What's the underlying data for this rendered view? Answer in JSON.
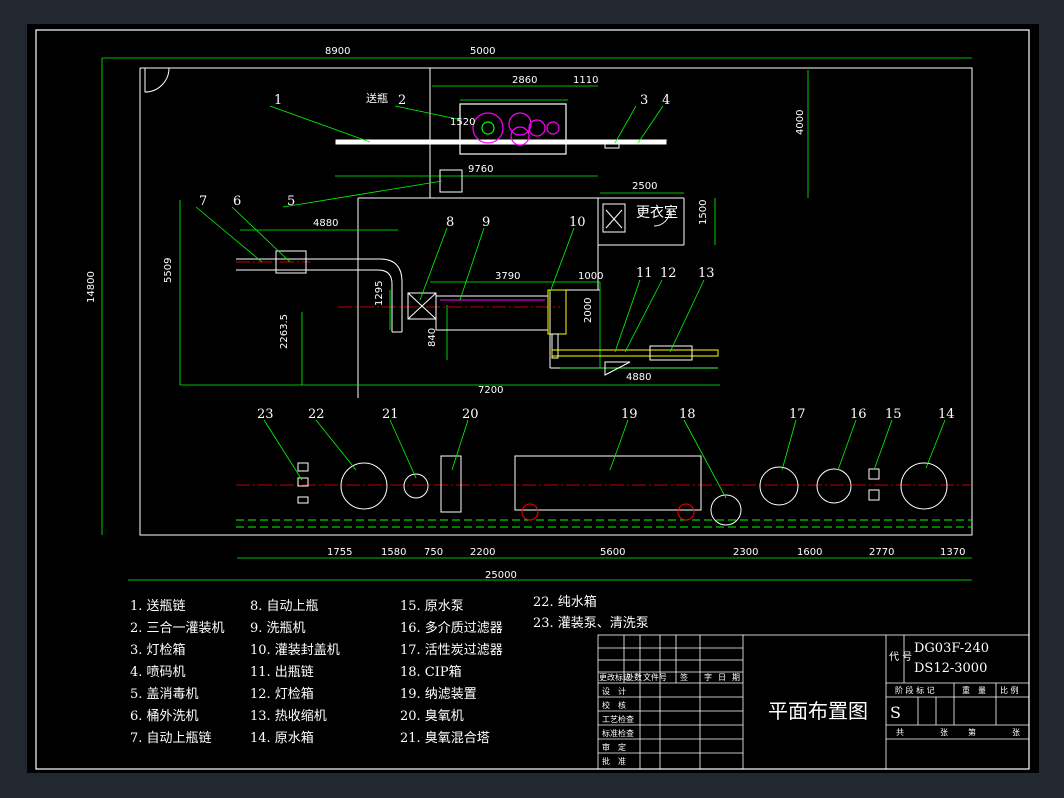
{
  "colors": {
    "background": "#212830",
    "canvas": "#000000",
    "line": "#ffffff",
    "dimension": "#00ff00",
    "leader": "#00ff00",
    "centerline": "#ff0000",
    "machine_magenta": "#ff00ff",
    "label_cyan": "#00ffff"
  },
  "drawing": {
    "dims": {
      "d8900": "8900",
      "d5000": "5000",
      "d2860": "2860",
      "d1110": "1110",
      "d1520": "1520",
      "d4000": "4000",
      "d9760": "9760",
      "d2500": "2500",
      "d1500": "1500",
      "d4880a": "4880",
      "d5509": "5509",
      "d1295": "1295",
      "d2263": "2263.5",
      "d840": "840",
      "d3790": "3790",
      "d1000": "1000",
      "d2000": "2000",
      "d4880b": "4880",
      "d7200": "7200",
      "d14800": "14800",
      "d1755": "1755",
      "d1580": "1580",
      "d750": "750",
      "d2200": "2200",
      "d5600": "5600",
      "d2300": "2300",
      "d1600": "1600",
      "d2770": "2770",
      "d1370": "1370",
      "d25000": "25000"
    },
    "labels": {
      "songping": "送瓶",
      "changing_room": "更衣室",
      "n1": "1",
      "n2": "2",
      "n3": "3",
      "n4": "4",
      "n5": "5",
      "n6": "6",
      "n7": "7",
      "n8": "8",
      "n9": "9",
      "n10": "10",
      "n11": "11",
      "n12": "12",
      "n13": "13",
      "n14": "14",
      "n15": "15",
      "n16": "16",
      "n17": "17",
      "n18": "18",
      "n19": "19",
      "n20": "20",
      "n21": "21",
      "n22": "22",
      "n23": "23"
    }
  },
  "legend": [
    "1.  送瓶链",
    "2.  三合一灌装机",
    "3.  灯检箱",
    "4.  喷码机",
    "5.  盖消毒机",
    "6.  桶外洗机",
    "7.  自动上瓶链",
    "8.  自动上瓶",
    "9.  洗瓶机",
    "10.  灌装封盖机",
    "11.  出瓶链",
    "12.  灯检箱",
    "13.  热收缩机",
    "14.  原水箱",
    "15.  原水泵",
    "16.  多介质过滤器",
    "17.  活性炭过滤器",
    "18.  CIP箱",
    "19.  纳滤装置",
    "20.  臭氧机",
    "21.  臭氧混合塔",
    "22.  纯水箱",
    "23.  灌装泵、清洗泵"
  ],
  "title_block": {
    "drawing_title": "平面布置图",
    "code_label": "代 号",
    "code_1": "DG03F-240",
    "code_2": "DS12-3000",
    "stage_mark": "S",
    "rev_headers": [
      "更改标记",
      "处数",
      "文件号",
      "签",
      "字",
      "日",
      "期"
    ],
    "sign_rows": [
      "设　计",
      "校　核",
      "工艺检查",
      "标准检查",
      "审　定",
      "批　准"
    ],
    "meta_headers": [
      "阶 段 标 记",
      "重　量",
      "比 例"
    ],
    "sheet_row": [
      "共",
      "张",
      "第",
      "张"
    ]
  }
}
